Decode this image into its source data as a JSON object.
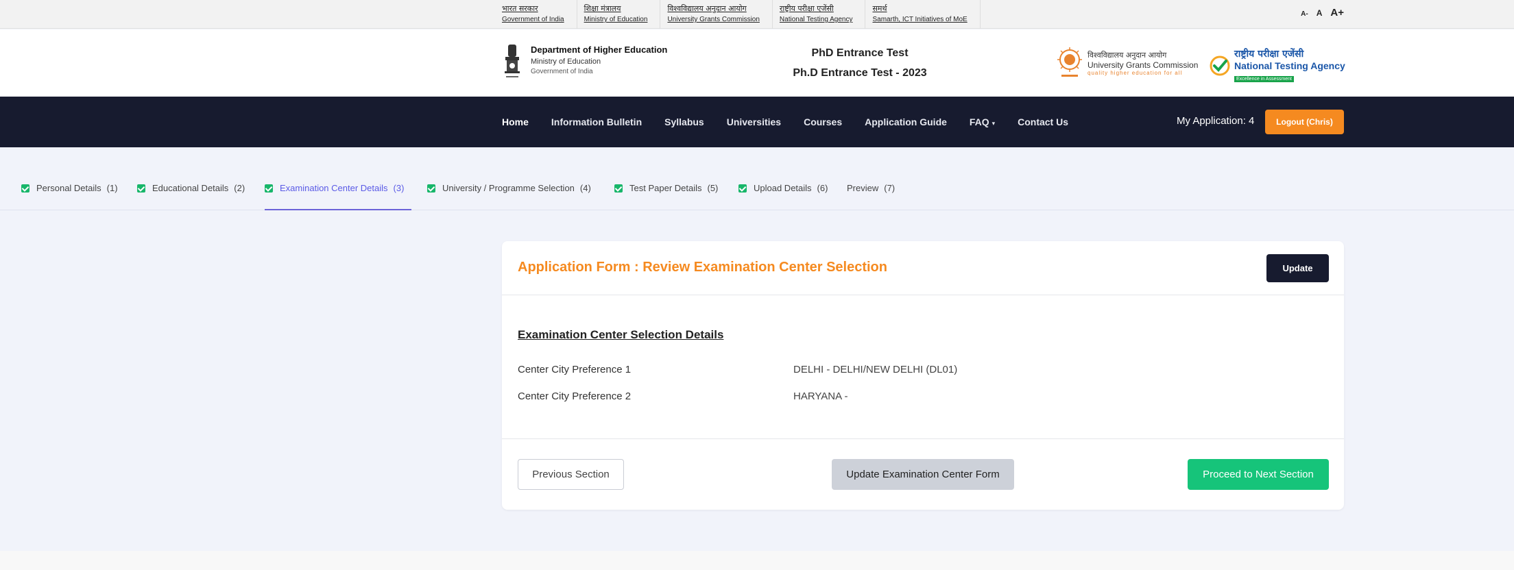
{
  "gov_links": [
    {
      "hi": "भारत सरकार",
      "en": "Government of India"
    },
    {
      "hi": "शिक्षा मंत्रालय",
      "en": "Ministry of Education"
    },
    {
      "hi": "विश्वविद्यालय अनुदान आयोग",
      "en": "University Grants Commission"
    },
    {
      "hi": "राष्ट्रीय परीक्षा एजेंसी",
      "en": "National Testing Agency"
    },
    {
      "hi": "समर्थ",
      "en": "Samarth, ICT Initiatives of MoE"
    }
  ],
  "font_controls": {
    "small": "A-",
    "normal": "A",
    "large": "A+"
  },
  "header": {
    "dept_title": "Department of Higher Education",
    "dept_ministry": "Ministry of Education",
    "dept_gov": "Government of India",
    "exam_line1": "PhD Entrance Test",
    "exam_line2": "Ph.D Entrance Test - 2023",
    "ugc_hi": "विश्वविद्यालय अनुदान आयोग",
    "ugc_en": "University Grants Commission",
    "ugc_tag": "quality higher education for all",
    "nta_hi": "राष्ट्रीय परीक्षा एजेंसी",
    "nta_en": "National Testing Agency",
    "nta_tag": "Excellence in Assessment"
  },
  "nav": {
    "items": [
      "Home",
      "Information Bulletin",
      "Syllabus",
      "Universities",
      "Courses",
      "Application Guide",
      "FAQ",
      "Contact Us"
    ],
    "my_application": "My Application: 4",
    "logout": "Logout (Chris)"
  },
  "steps": [
    {
      "label": "Personal Details",
      "num": "(1)",
      "done": true
    },
    {
      "label": "Educational Details",
      "num": "(2)",
      "done": true
    },
    {
      "label": "Examination Center Details",
      "num": "(3)",
      "done": true
    },
    {
      "label": "University / Programme Selection",
      "num": "(4)",
      "done": true
    },
    {
      "label": "Test Paper Details",
      "num": "(5)",
      "done": true
    },
    {
      "label": "Upload Details",
      "num": "(6)",
      "done": true
    },
    {
      "label": "Preview",
      "num": "(7)",
      "done": false
    }
  ],
  "card": {
    "title": "Application Form : Review Examination Center Selection",
    "update": "Update",
    "section_title": "Examination Center Selection Details",
    "rows": [
      {
        "label": "Center City Preference 1",
        "value": "DELHI - DELHI/NEW DELHI (DL01)"
      },
      {
        "label": "Center City Preference 2",
        "value": "HARYANA -"
      }
    ],
    "prev": "Previous Section",
    "update_form": "Update Examination Center Form",
    "next": "Proceed to Next Section"
  },
  "colors": {
    "accent": "#f58a20",
    "nav_bg": "#171b2f",
    "success": "#16c47a",
    "active_tab": "#6c63d8"
  }
}
